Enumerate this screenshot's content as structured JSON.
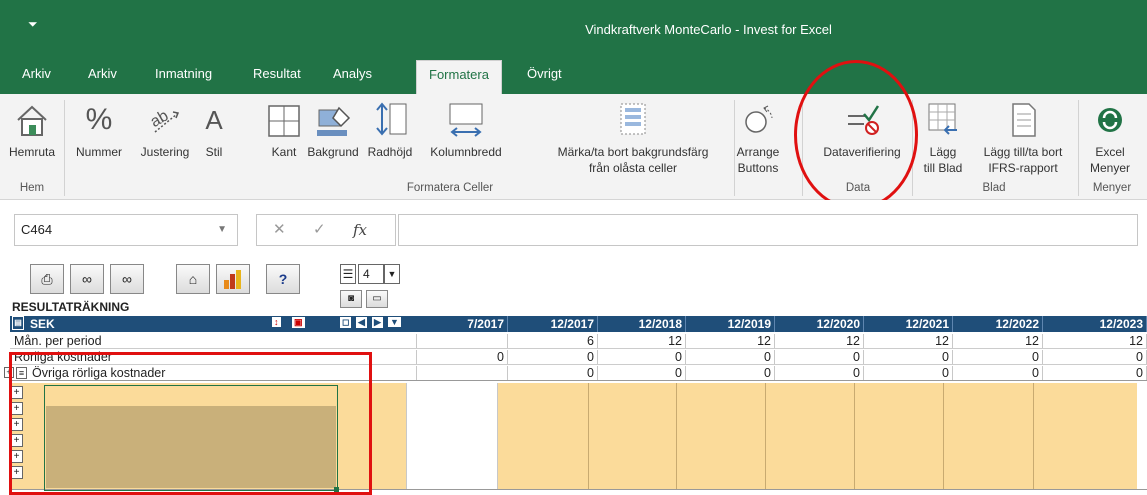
{
  "window": {
    "title": "Vindkraftverk MonteCarlo - Invest for Excel",
    "qat_icon": "quick-access-icon"
  },
  "tabs": [
    {
      "label": "Arkiv"
    },
    {
      "label": "Arkiv"
    },
    {
      "label": "Inmatning"
    },
    {
      "label": "Resultat"
    },
    {
      "label": "Analys"
    },
    {
      "label": "Formatera",
      "active": true
    },
    {
      "label": "Övrigt"
    }
  ],
  "ribbon": {
    "buttons": [
      {
        "label": "Hemruta",
        "icon": "home-icon"
      },
      {
        "label": "Nummer",
        "icon": "percent-icon"
      },
      {
        "label": "Justering",
        "icon": "orientation-icon"
      },
      {
        "label": "Stil",
        "icon": "font-a-icon"
      },
      {
        "label": "Kant",
        "icon": "border-icon"
      },
      {
        "label": "Bakgrund",
        "icon": "fill-color-icon"
      },
      {
        "label": "Radhöjd",
        "icon": "row-height-icon"
      },
      {
        "label": "Kolumnbredd",
        "icon": "column-width-icon"
      },
      {
        "label1": "Märka/ta bort bakgrundsfärg",
        "label2": "från olåsta celler",
        "icon": "unlocked-cells-icon"
      },
      {
        "label1": "Arrange",
        "label2": "Buttons",
        "icon": "arrange-icon"
      },
      {
        "label": "Dataverifiering",
        "icon": "data-validation-icon"
      },
      {
        "label1": "Lägg",
        "label2": "till Blad",
        "icon": "add-sheet-icon"
      },
      {
        "label1": "Lägg till/ta bort",
        "label2": "IFRS-rapport",
        "icon": "report-icon"
      },
      {
        "label1": "Excel",
        "label2": "Menyer",
        "icon": "excel-menu-icon"
      }
    ],
    "groups": {
      "hem": "Hem",
      "formatera_celler": "Formatera Celler",
      "data": "Data",
      "blad": "Blad",
      "menyer": "Menyer"
    }
  },
  "formula_bar": {
    "name_box": "C464",
    "cancel": "✕",
    "enter": "✓",
    "fx": "fx",
    "value": ""
  },
  "sheet": {
    "toolbar_buttons": [
      {
        "icon": "print-icon"
      },
      {
        "icon": "handshake-left-icon"
      },
      {
        "icon": "handshake-right-icon"
      },
      {
        "icon": "home-icon"
      },
      {
        "icon": "bar-chart-icon"
      },
      {
        "icon": "help-icon",
        "text": "?"
      }
    ],
    "level_selector": "4",
    "title": "RESULTATRÄKNING",
    "header": {
      "label": "SEK",
      "periods": [
        "7/2017",
        "12/2017",
        "12/2018",
        "12/2019",
        "12/2020",
        "12/2021",
        "12/2022",
        "12/2023"
      ]
    },
    "rows": [
      {
        "label": "Mån. per period",
        "values": [
          "",
          "6",
          "12",
          "12",
          "12",
          "12",
          "12",
          "12"
        ]
      },
      {
        "label": "Rörliga kostnader",
        "values": [
          "0",
          "0",
          "0",
          "0",
          "0",
          "0",
          "0",
          "0"
        ]
      },
      {
        "label": "Övriga rörliga kostnader",
        "values": [
          "",
          "0",
          "0",
          "0",
          "0",
          "0",
          "0",
          "0"
        ]
      }
    ]
  },
  "colors": {
    "excel_green": "#217346",
    "header_blue": "#1f4e79",
    "highlight_red": "#e01010",
    "cell_yellow": "#fbdb9a"
  }
}
